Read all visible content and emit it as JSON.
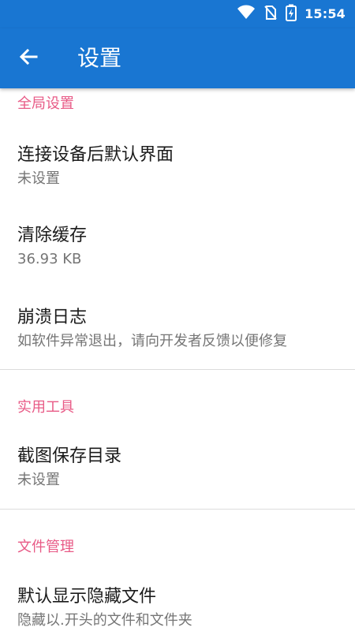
{
  "status_bar": {
    "time": "15:54",
    "icons": [
      "wifi-icon",
      "no-sim-icon",
      "battery-charging-icon"
    ]
  },
  "app_bar": {
    "back_icon": "arrow-left-icon",
    "title": "设置"
  },
  "sections": [
    {
      "header": "全局设置",
      "items": [
        {
          "title": "连接设备后默认界面",
          "summary": "未设置"
        },
        {
          "title": "清除缓存",
          "summary": "36.93 KB"
        },
        {
          "title": "崩溃日志",
          "summary": "如软件异常退出，请向开发者反馈以便修复"
        }
      ]
    },
    {
      "header": "实用工具",
      "items": [
        {
          "title": "截图保存目录",
          "summary": "未设置"
        }
      ]
    },
    {
      "header": "文件管理",
      "items": [
        {
          "title": "默认显示隐藏文件",
          "summary": "隐藏以.开头的文件和文件夹"
        }
      ]
    }
  ],
  "colors": {
    "primary": "#1976d2",
    "section_header": "#e85a86",
    "title_text": "#1b1b1b",
    "summary_text": "#757575",
    "divider": "#dcdcdc"
  }
}
